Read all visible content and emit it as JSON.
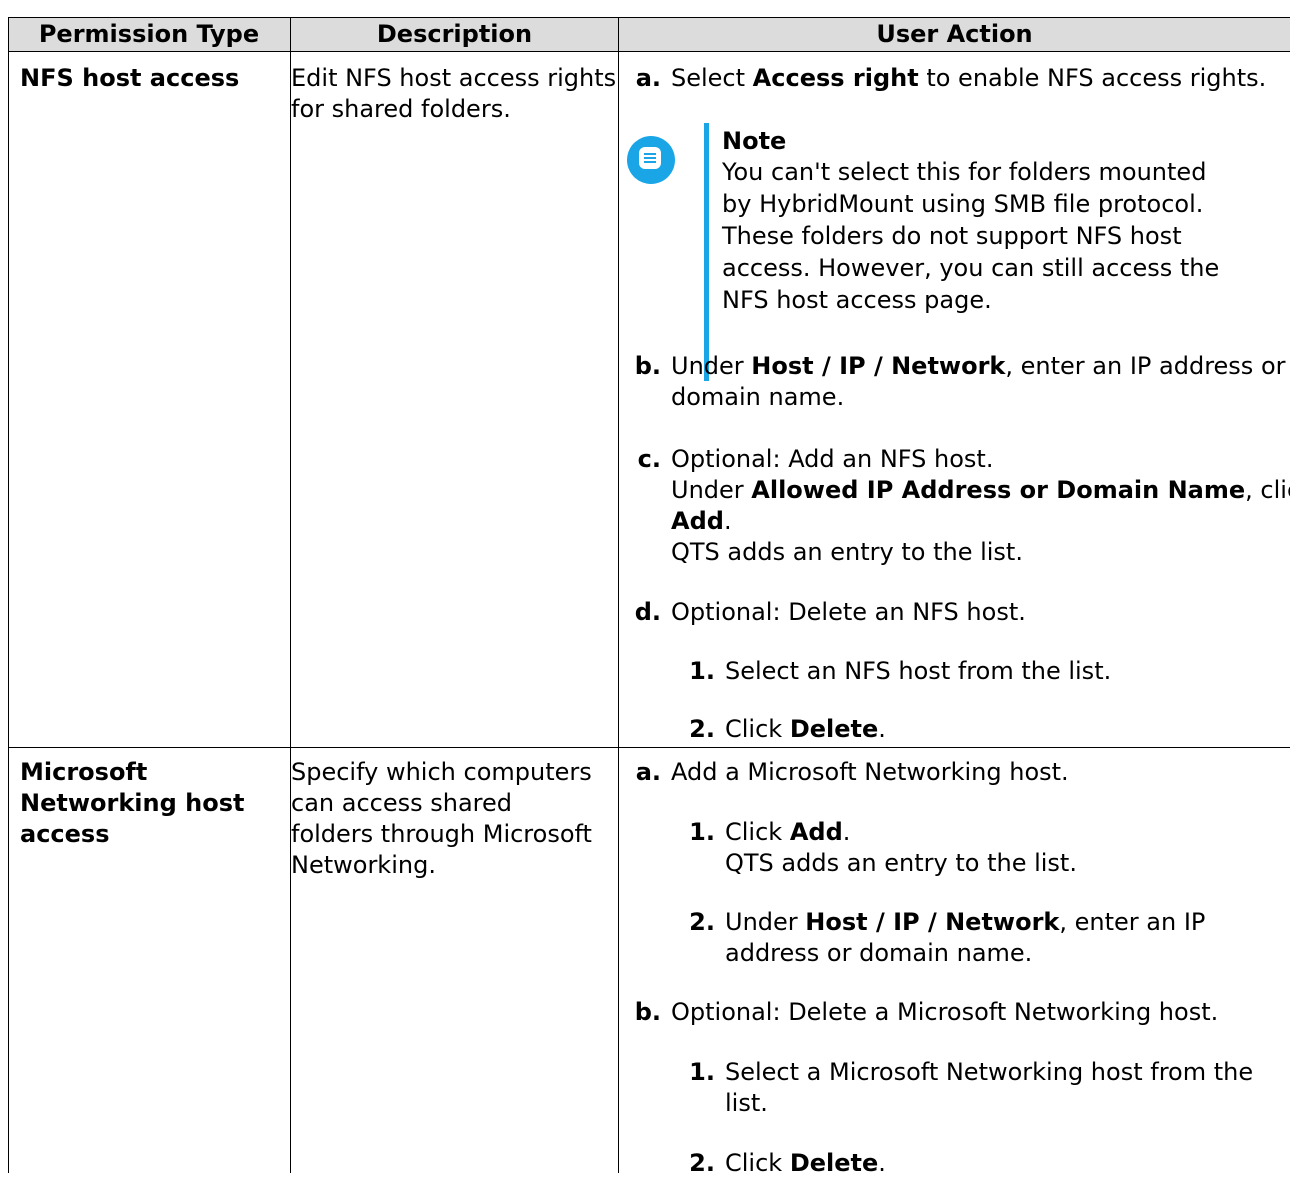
{
  "headers": {
    "permission_type": "Permission Type",
    "description": "Description",
    "user_action": "User Action"
  },
  "rows": [
    {
      "type": "NFS host access",
      "description_lines": [
        "Edit NFS host access rights",
        "for shared folders."
      ],
      "steps": {
        "a": {
          "label": "a.",
          "pre": "Select ",
          "bold": "Access right",
          "post": " to enable NFS access rights."
        },
        "note": {
          "title": "Note",
          "lines": [
            "You can't select this for folders mounted",
            "by HybridMount using SMB file protocol.",
            "These folders do not support NFS host",
            "access. However, you can still access the",
            "NFS host access page."
          ]
        },
        "b": {
          "label": "b.",
          "pre": "Under ",
          "bold": "Host / IP / Network",
          "post": ", enter an IP address or",
          "line2": "domain name."
        },
        "c": {
          "label": "c.",
          "line1": "Optional: Add an NFS host.",
          "line2_pre": "Under ",
          "line2_bold": "Allowed IP Address or Domain Name",
          "line2_post": ", click",
          "line3_bold": "Add",
          "line3_post": ".",
          "line4": "QTS adds an entry to the list."
        },
        "d": {
          "label": "d.",
          "text": "Optional: Delete an NFS host.",
          "sub": [
            {
              "label": "1.",
              "text": "Select an NFS host from the list."
            },
            {
              "label": "2.",
              "pre": "Click ",
              "bold": "Delete",
              "post": "."
            }
          ]
        }
      }
    },
    {
      "type_lines": [
        "Microsoft",
        "Networking host",
        "access"
      ],
      "description_lines": [
        "Specify which computers",
        "can access shared",
        "folders through Microsoft",
        "Networking."
      ],
      "steps": {
        "a": {
          "label": "a.",
          "text": "Add a Microsoft Networking host.",
          "sub": [
            {
              "label": "1.",
              "pre": "Click ",
              "bold": "Add",
              "post": ".",
              "line2": "QTS adds an entry to the list."
            },
            {
              "label": "2.",
              "pre": "Under ",
              "bold": "Host / IP / Network",
              "post": ", enter an IP",
              "line2": "address or domain name."
            }
          ]
        },
        "b": {
          "label": "b.",
          "text": "Optional: Delete a Microsoft Networking host.",
          "sub": [
            {
              "label": "1.",
              "text": "Select a Microsoft Networking host from the",
              "line2": "list."
            },
            {
              "label": "2.",
              "pre": "Click ",
              "bold": "Delete",
              "post": "."
            }
          ]
        }
      }
    }
  ],
  "colors": {
    "header_bg": "#dcdcdc",
    "note_accent": "#1aa6e6",
    "border": "#000000"
  }
}
